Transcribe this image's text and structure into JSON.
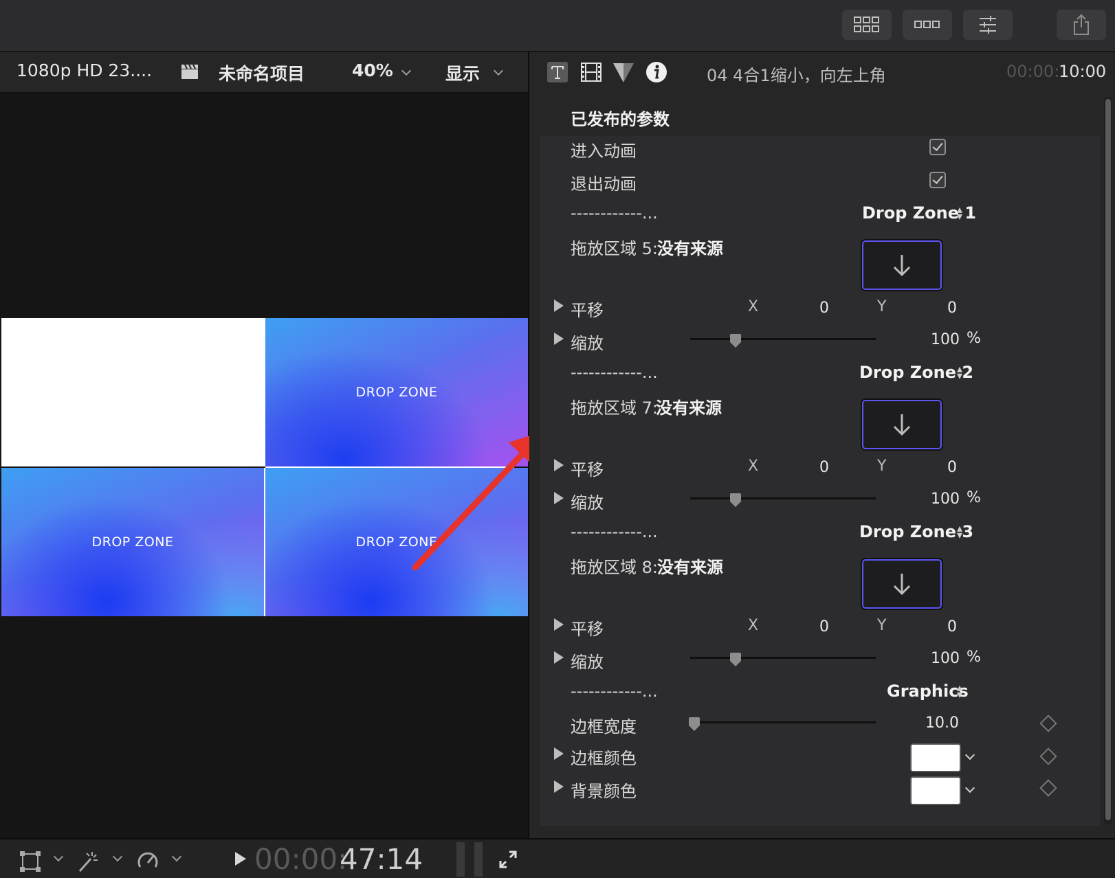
{
  "viewer": {
    "format": "1080p HD 23....",
    "project_name": "未命名项目",
    "zoom": "40%",
    "display_menu": "显示",
    "tiles": [
      "DROP ZONE",
      "DROP ZONE",
      "DROP ZONE"
    ],
    "timecode_dim": "00:00:",
    "timecode_bright": "47:14"
  },
  "inspector": {
    "clip_title": "04 4合1缩小，向左上角",
    "duration_dim": "00:00:",
    "duration_bright": "10:00",
    "section_title": "已发布的参数",
    "enter_anim": "进入动画",
    "exit_anim": "退出动画",
    "zones": [
      {
        "separator": "------------...",
        "name": "Drop Zone 1",
        "well_label": "拖放区域 5:",
        "source": "没有来源",
        "translate": "平移",
        "x_label": "X",
        "x": "0",
        "y_label": "Y",
        "y": "0",
        "scale": "缩放",
        "scale_value": "100",
        "unit": "%"
      },
      {
        "separator": "------------...",
        "name": "Drop Zone 2",
        "well_label": "拖放区域 7:",
        "source": "没有来源",
        "translate": "平移",
        "x_label": "X",
        "x": "0",
        "y_label": "Y",
        "y": "0",
        "scale": "缩放",
        "scale_value": "100",
        "unit": "%"
      },
      {
        "separator": "------------...",
        "name": "Drop Zone 3",
        "well_label": "拖放区域 8:",
        "source": "没有来源",
        "translate": "平移",
        "x_label": "X",
        "x": "0",
        "y_label": "Y",
        "y": "0",
        "scale": "缩放",
        "scale_value": "100",
        "unit": "%"
      }
    ],
    "graphics": {
      "separator": "------------...",
      "name": "Graphics",
      "border_width_label": "边框宽度",
      "border_width": "10.0",
      "border_color_label": "边框颜色",
      "border_color": "#ffffff",
      "bg_color_label": "背景颜色",
      "bg_color": "#ffffff"
    }
  },
  "colors": {
    "accent_well": "#5d55f0",
    "annotation_arrow": "#e8332a"
  }
}
